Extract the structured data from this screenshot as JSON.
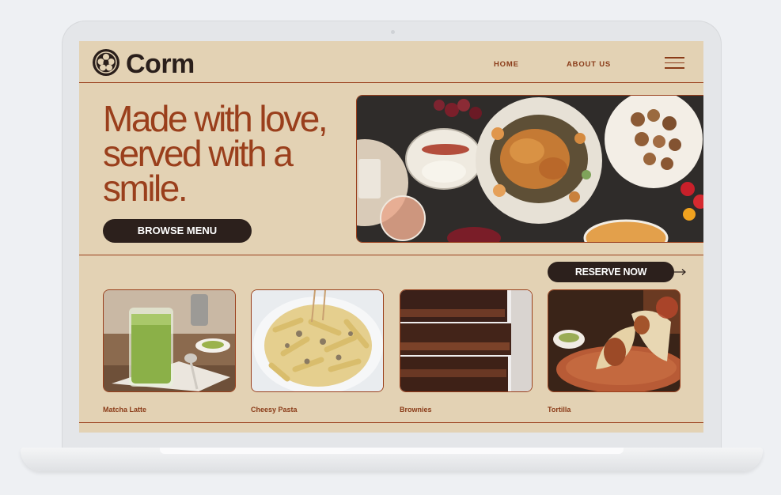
{
  "brand": {
    "name": "Corm"
  },
  "nav": {
    "home": "HOME",
    "about": "ABOUT US"
  },
  "hero": {
    "headline_lines": [
      "Made with love,",
      "served with a",
      "smile."
    ],
    "browse_label": "BROWSE MENU"
  },
  "reserve": {
    "label": "RESERVE NOW"
  },
  "menu": {
    "items": [
      {
        "label": "Matcha Latte"
      },
      {
        "label": "Cheesy Pasta"
      },
      {
        "label": "Brownies"
      },
      {
        "label": "Tortilla"
      }
    ]
  },
  "colors": {
    "background": "#e3d2b4",
    "accent": "#9a3f1c",
    "button": "#2c201c"
  }
}
